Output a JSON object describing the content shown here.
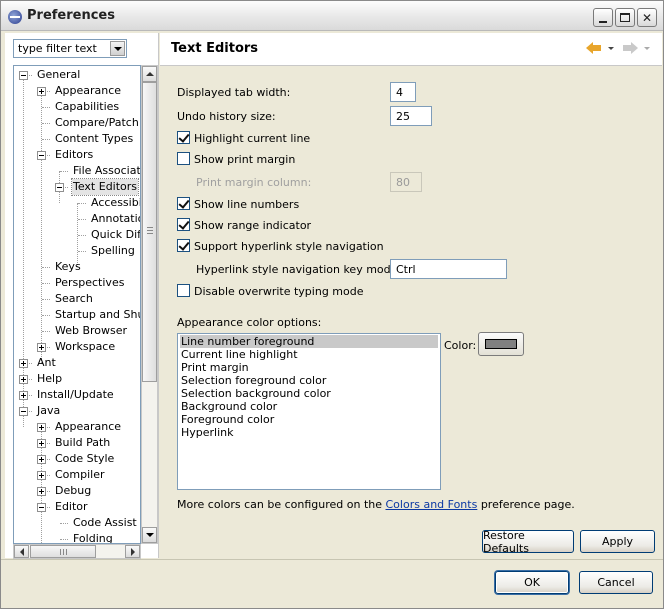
{
  "window": {
    "title": "Preferences"
  },
  "filter": {
    "placeholder": "type filter text"
  },
  "tree": {
    "items": [
      {
        "label": "General",
        "toggle": "minus"
      },
      {
        "label": "Appearance",
        "toggle": "plus"
      },
      {
        "label": "Capabilities",
        "toggle": ""
      },
      {
        "label": "Compare/Patch",
        "toggle": ""
      },
      {
        "label": "Content Types",
        "toggle": ""
      },
      {
        "label": "Editors",
        "toggle": "minus"
      },
      {
        "label": "File Associatio",
        "toggle": ""
      },
      {
        "label": "Text Editors",
        "toggle": "minus",
        "selected": true
      },
      {
        "label": "Accessibili",
        "toggle": ""
      },
      {
        "label": "Annotatio",
        "toggle": ""
      },
      {
        "label": "Quick Diff",
        "toggle": ""
      },
      {
        "label": "Spelling",
        "toggle": ""
      },
      {
        "label": "Keys",
        "toggle": ""
      },
      {
        "label": "Perspectives",
        "toggle": ""
      },
      {
        "label": "Search",
        "toggle": ""
      },
      {
        "label": "Startup and Shutd",
        "toggle": ""
      },
      {
        "label": "Web Browser",
        "toggle": ""
      },
      {
        "label": "Workspace",
        "toggle": "plus"
      },
      {
        "label": "Ant",
        "toggle": "plus"
      },
      {
        "label": "Help",
        "toggle": "plus"
      },
      {
        "label": "Install/Update",
        "toggle": "plus"
      },
      {
        "label": "Java",
        "toggle": "minus"
      },
      {
        "label": "Appearance",
        "toggle": "plus"
      },
      {
        "label": "Build Path",
        "toggle": "plus"
      },
      {
        "label": "Code Style",
        "toggle": "plus"
      },
      {
        "label": "Compiler",
        "toggle": "plus"
      },
      {
        "label": "Debug",
        "toggle": "plus"
      },
      {
        "label": "Editor",
        "toggle": "minus"
      },
      {
        "label": "Code Assist",
        "toggle": ""
      },
      {
        "label": "Folding",
        "toggle": ""
      }
    ]
  },
  "page": {
    "title": "Text Editors",
    "tab_width_label": "Displayed tab width:",
    "tab_width_value": "4",
    "undo_label": "Undo history size:",
    "undo_value": "25",
    "highlight_line_label": "Highlight current line",
    "highlight_line_checked": true,
    "print_margin_label": "Show print margin",
    "print_margin_checked": false,
    "print_margin_column_label": "Print margin column:",
    "print_margin_column_value": "80",
    "line_numbers_label": "Show line numbers",
    "line_numbers_checked": true,
    "range_indicator_label": "Show range indicator",
    "range_indicator_checked": true,
    "hyperlink_nav_label": "Support hyperlink style navigation",
    "hyperlink_nav_checked": true,
    "hyperlink_modifier_label": "Hyperlink style navigation key modifier:",
    "hyperlink_modifier_value": "Ctrl",
    "overwrite_label": "Disable overwrite typing mode",
    "overwrite_checked": false,
    "color_options_label": "Appearance color options:",
    "color_options": [
      "Line number foreground",
      "Current line highlight",
      "Print margin",
      "Selection foreground color",
      "Selection background color",
      "Background color",
      "Foreground color",
      "Hyperlink"
    ],
    "color_selected_index": 0,
    "color_label": "Color:",
    "color_value": "#808080",
    "more_colors_prefix": "More colors can be configured on the ",
    "more_colors_link": "Colors and Fonts",
    "more_colors_suffix": " preference page.",
    "restore_defaults": "Restore Defaults",
    "apply": "Apply"
  },
  "footer": {
    "ok": "OK",
    "cancel": "Cancel"
  }
}
